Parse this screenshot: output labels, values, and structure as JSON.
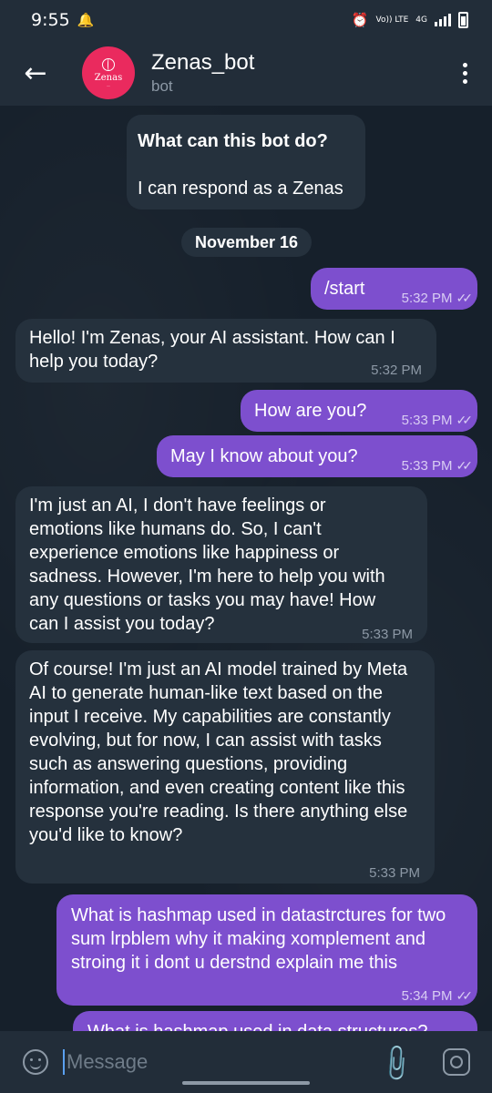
{
  "status": {
    "time": "9:55",
    "bell_icon": "notification-bell-icon",
    "volte": "Vo)) LTE",
    "network": "4G"
  },
  "header": {
    "title": "Zenas_bot",
    "subtitle": "bot",
    "avatar_text": "Zenas"
  },
  "intro": {
    "heading": "What can this bot do?",
    "text": "I can respond as a Zenas"
  },
  "date_label": "November 16",
  "messages": [
    {
      "dir": "out",
      "text": "/start",
      "time": "5:32 PM"
    },
    {
      "dir": "in",
      "text": "Hello! I'm Zenas, your AI assistant. How can I help you today?",
      "time": "5:32 PM"
    },
    {
      "dir": "out",
      "text": "How are you?",
      "time": "5:33 PM"
    },
    {
      "dir": "out",
      "text": "May I know about you?",
      "time": "5:33 PM"
    },
    {
      "dir": "in",
      "text": "I'm just an AI, I don't have feelings or emotions like humans do. So, I can't experience emotions like happiness or sadness. However, I'm here to help you with any questions or tasks you may have! How can I assist you today?",
      "time": "5:33 PM"
    },
    {
      "dir": "in",
      "text": "Of course! I'm just an AI model trained by Meta AI to generate human-like text based on the input I receive. My capabilities are constantly evolving, but for now, I can assist with tasks such as answering questions, providing information, and even creating content like this response you're reading. Is there anything else you'd like to know?",
      "time": "5:33 PM"
    },
    {
      "dir": "out",
      "text": "What is hashmap used in datastrctures for two sum lrpblem why it making xomplement and stroing it i dont u derstnd explain me this",
      "time": "5:34 PM"
    },
    {
      "dir": "out",
      "text": "What is hashmap used in data structures?",
      "time": ""
    }
  ],
  "input": {
    "placeholder": "Message"
  },
  "colors": {
    "background": "#16202b",
    "header": "#222d39",
    "incoming_bubble": "#25313d",
    "outgoing_bubble": "#7d4fce",
    "avatar": "#ea2a5e"
  }
}
